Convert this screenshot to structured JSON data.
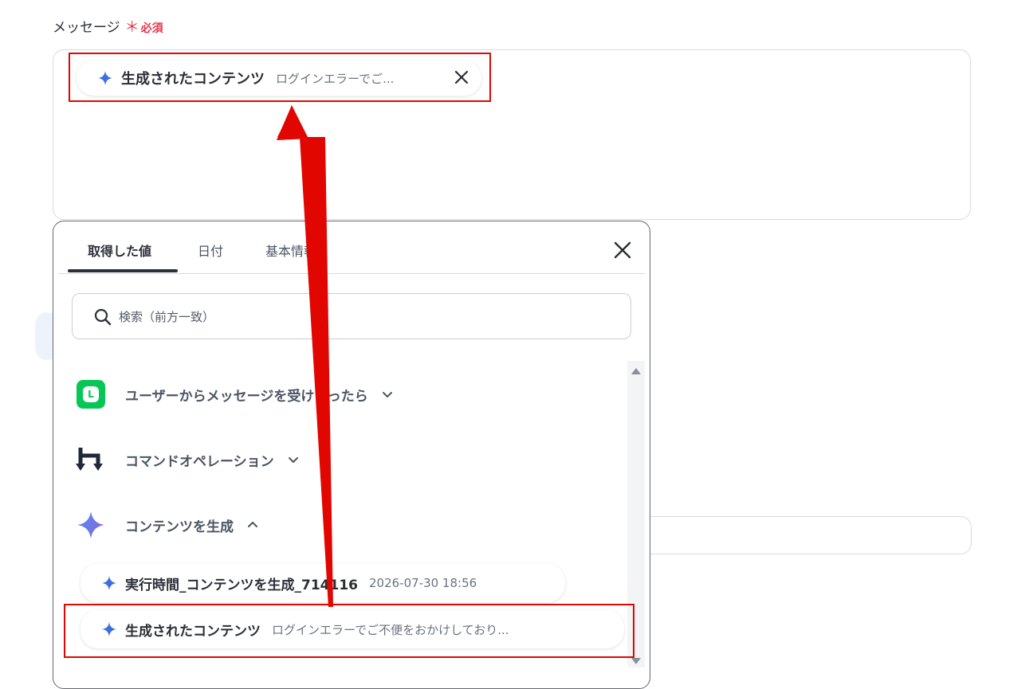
{
  "field": {
    "label": "メッセージ",
    "required_star": "＊",
    "required_text": "必須"
  },
  "message_chip": {
    "title": "生成されたコンテンツ",
    "value": "ログインエラーでご...",
    "icon": "sparkle-icon"
  },
  "picker": {
    "tabs": [
      {
        "label": "取得した値",
        "active": true
      },
      {
        "label": "日付",
        "active": false
      },
      {
        "label": "基本情報",
        "active": false
      }
    ],
    "search_placeholder": "検索（前方一致）",
    "groups": [
      {
        "label": "ユーザーからメッセージを受けとったら",
        "icon": "line-app-icon",
        "expanded": false
      },
      {
        "label": "コマンドオペレーション",
        "icon": "command-operation-icon",
        "expanded": false
      },
      {
        "label": "コンテンツを生成",
        "icon": "sparkle-icon",
        "expanded": true
      }
    ],
    "items": [
      {
        "title": "実行時間_コンテンツを生成_714116",
        "value": "2026-07-30 18:56"
      },
      {
        "title": "生成されたコンテンツ",
        "value": "ログインエラーでご不便をおかけしており..."
      }
    ]
  },
  "colors": {
    "required": "#e5374b",
    "highlight": "#e10600",
    "line_green": "#06c755",
    "sparkle_blue": "#3b6fe0"
  }
}
